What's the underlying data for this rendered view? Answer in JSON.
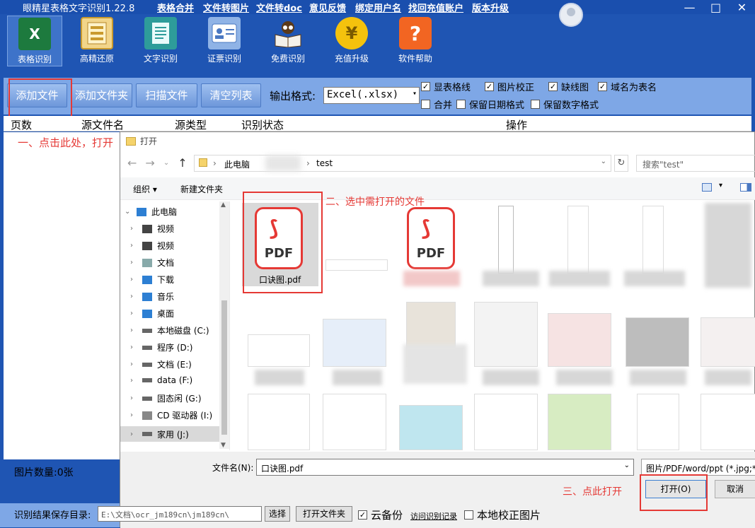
{
  "app": {
    "title": "眼精星表格文字识别1.22.8",
    "menu": [
      "表格合并",
      "文件转图片",
      "文件转doc",
      "意见反馈",
      "绑定用户名",
      "找回充值账户",
      "版本升级"
    ],
    "window_buttons": [
      "—",
      "□",
      "✕"
    ]
  },
  "toolbar": [
    {
      "label": "表格识别",
      "icon": "excel-icon"
    },
    {
      "label": "高精还原",
      "icon": "document-layout-icon"
    },
    {
      "label": "文字识别",
      "icon": "text-doc-icon"
    },
    {
      "label": "证票识别",
      "icon": "id-card-icon"
    },
    {
      "label": "免费识别",
      "icon": "book-icon"
    },
    {
      "label": "充值升级",
      "icon": "coin-icon"
    },
    {
      "label": "软件帮助",
      "icon": "help-icon"
    }
  ],
  "actions": {
    "add_file": "添加文件",
    "add_folder": "添加文件夹",
    "scan_file": "扫描文件",
    "clear_list": "清空列表",
    "output_format_label": "输出格式:",
    "output_format_value": "Excel(.xlsx)"
  },
  "options": [
    {
      "label": "显表格线",
      "checked": true
    },
    {
      "label": "图片校正",
      "checked": true
    },
    {
      "label": "缺线图",
      "checked": true
    },
    {
      "label": "域名为表名",
      "checked": true
    },
    {
      "label": "合并",
      "checked": false
    },
    {
      "label": "保留日期格式",
      "checked": false
    },
    {
      "label": "保留数字格式",
      "checked": false
    }
  ],
  "table_headers": [
    "页数",
    "源文件名",
    "源类型",
    "识别状态",
    "操作"
  ],
  "instructions": {
    "step1": "一、点击此处，打开",
    "step2": "二、选中需打开的文件",
    "step3": "三、点此打开"
  },
  "bottom": {
    "image_count": "图片数量:0张",
    "save_dir_label": "识别结果保存目录:",
    "save_dir_value": "E:\\文档\\ocr_jm189cn\\jm189cn\\",
    "choose": "选择",
    "open_folder": "打开文件夹",
    "cloud_backup": "云备份",
    "view_records": "访问识别记录",
    "local_correct": "本地校正图片"
  },
  "dialog": {
    "title": "打开",
    "path": [
      "此电脑",
      "test"
    ],
    "search_placeholder": "搜索\"test\"",
    "organize": "组织 ▾",
    "new_folder": "新建文件夹",
    "tree": [
      {
        "label": "此电脑",
        "level": 0,
        "expanded": true
      },
      {
        "label": "视频",
        "level": 1
      },
      {
        "label": "视频",
        "level": 1
      },
      {
        "label": "文档",
        "level": 1
      },
      {
        "label": "下载",
        "level": 1
      },
      {
        "label": "音乐",
        "level": 1
      },
      {
        "label": "桌面",
        "level": 1
      },
      {
        "label": "本地磁盘 (C:)",
        "level": 1
      },
      {
        "label": "程序 (D:)",
        "level": 1
      },
      {
        "label": "文档 (E:)",
        "level": 1
      },
      {
        "label": "data (F:)",
        "level": 1
      },
      {
        "label": "固态闲 (G:)",
        "level": 1
      },
      {
        "label": "CD 驱动器 (I:)",
        "level": 1
      },
      {
        "label": "家用 (J:)",
        "level": 1,
        "selected": true
      }
    ],
    "selected_file": "口诀图.pdf",
    "pdf_label": "PDF",
    "filename_label": "文件名(N):",
    "filename_value": "口诀图.pdf",
    "filter": "图片/PDF/word/ppt (*.jpg;*",
    "open_button": "打开(O)",
    "cancel_button": "取消"
  },
  "colors": {
    "accent": "#1f55b3",
    "bar": "#7ea7e6",
    "annotation": "#e53935"
  }
}
